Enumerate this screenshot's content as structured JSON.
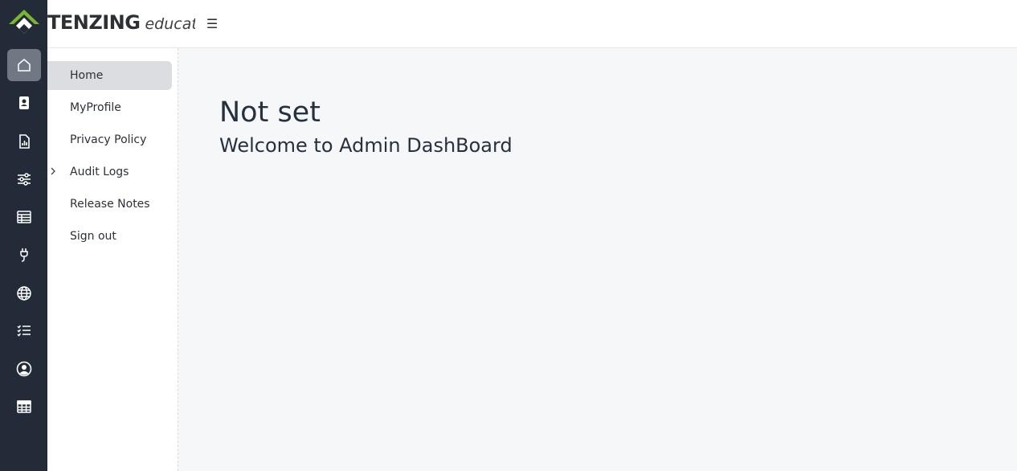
{
  "brand": {
    "name": "TENZING",
    "sub": "education",
    "colors": {
      "green": "#7ab532",
      "dark": "#2d3136"
    }
  },
  "header": {
    "menu_toggle": "☰"
  },
  "rail": {
    "items": [
      {
        "icon": "home-icon",
        "active": true
      },
      {
        "icon": "id-badge-icon",
        "active": false
      },
      {
        "icon": "report-file-icon",
        "active": false
      },
      {
        "icon": "sliders-icon",
        "active": false
      },
      {
        "icon": "spreadsheet-icon",
        "active": false
      },
      {
        "icon": "plug-icon",
        "active": false
      },
      {
        "icon": "globe-icon",
        "active": false
      },
      {
        "icon": "checklist-icon",
        "active": false
      },
      {
        "icon": "user-circle-icon",
        "active": false
      },
      {
        "icon": "table-grid-icon",
        "active": false
      }
    ]
  },
  "sidebar": {
    "items": [
      {
        "label": "Home",
        "active": true
      },
      {
        "label": "MyProfile"
      },
      {
        "label": "Privacy Policy"
      },
      {
        "label": "Audit Logs",
        "expandable": true
      },
      {
        "label": "Release Notes"
      },
      {
        "label": "Sign out"
      }
    ]
  },
  "main": {
    "title": "Not set",
    "subtitle": "Welcome to Admin DashBoard"
  }
}
